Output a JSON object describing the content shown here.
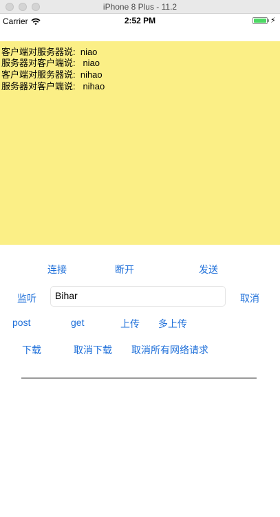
{
  "window": {
    "title": "iPhone 8 Plus - 11.2"
  },
  "status_bar": {
    "carrier": "Carrier",
    "time": "2:52 PM",
    "battery_level": 1.0
  },
  "log": {
    "lines": [
      "客户端对服务器说:  niao",
      "服务器对客户端说:   niao",
      "客户端对服务器说:  nihao",
      "服务器对客户端说:   nihao"
    ]
  },
  "socket_controls": {
    "connect": "连接",
    "disconnect": "断开",
    "send": "发送"
  },
  "listen_row": {
    "listen": "监听",
    "input_value": "Bihar",
    "cancel": "取消"
  },
  "http_row": {
    "post": "post",
    "get": "get",
    "upload": "上传",
    "multi_upload": "多上传"
  },
  "download_row": {
    "download": "下载",
    "cancel_download": "取消下载",
    "cancel_all": "取消所有网络请求"
  },
  "progress": {
    "value": 0
  },
  "colors": {
    "log_background": "#fbef86",
    "button_text": "#1e6fd9",
    "battery": "#4cd964"
  }
}
